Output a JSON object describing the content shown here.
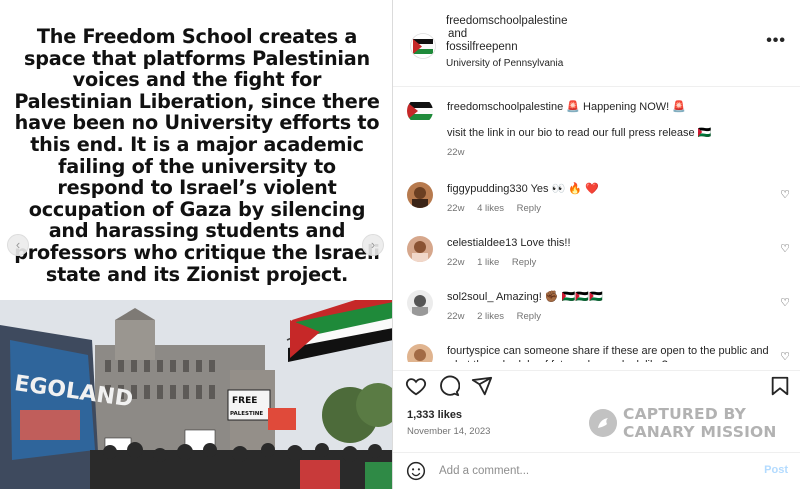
{
  "post": {
    "quote_text": "The Freedom School creates a space that platforms Palestinian voices and the fight for Palestinian Liberation, since there have been no University efforts to this end. It is a major academic failing of the university to respond to Israel’s violent occupation of Gaza by silencing and harassing students and professors who critique the Israeli state and its Zionist project.",
    "nav_prev_icon": "chevron-left-icon",
    "nav_next_icon": "chevron-right-icon",
    "photo_signs": [
      "FREE PALESTINE",
      "EGOLAND"
    ]
  },
  "header": {
    "author": "freedomschoolpalestine",
    "and_text": "and",
    "coauthor": "fossilfreepenn",
    "location": "University of Pennsylvania",
    "more_label": "•••"
  },
  "caption": {
    "user": "freedomschoolpalestine",
    "text_1": "🚨 Happening NOW! 🚨",
    "text_2": "visit the link in our bio to read our full press release 🇵🇸",
    "time": "22w"
  },
  "comments": [
    {
      "user": "figgypudding330",
      "text": "Yes 👀 🔥 ❤️",
      "time": "22w",
      "likes": "4 likes",
      "reply": "Reply"
    },
    {
      "user": "celestialdee13",
      "text": "Love this!!",
      "time": "22w",
      "likes": "1 like",
      "reply": "Reply"
    },
    {
      "user": "sol2soul_",
      "text": "Amazing! ✊🏾 🇵🇸🇵🇸🇵🇸",
      "time": "22w",
      "likes": "2 likes",
      "reply": "Reply"
    },
    {
      "user": "fourtyspice",
      "text": "can someone share if these are open to the public and what the schedule of future classes look like?",
      "time": "",
      "likes": "",
      "reply": ""
    }
  ],
  "actions": {
    "like_icon": "heart-icon",
    "comment_icon": "comment-icon",
    "share_icon": "share-icon",
    "save_icon": "bookmark-icon"
  },
  "stats": {
    "likes": "1,333 likes",
    "date": "November 14, 2023"
  },
  "watermark": {
    "line1": "CAPTURED BY",
    "line2": "CANARY MISSION"
  },
  "composer": {
    "placeholder": "Add a comment...",
    "post_label": "Post",
    "emoji_icon": "smiley-icon"
  },
  "colors": {
    "link_disabled": "#b3dbff",
    "muted": "#737373",
    "heart_red": "#ed4956"
  }
}
